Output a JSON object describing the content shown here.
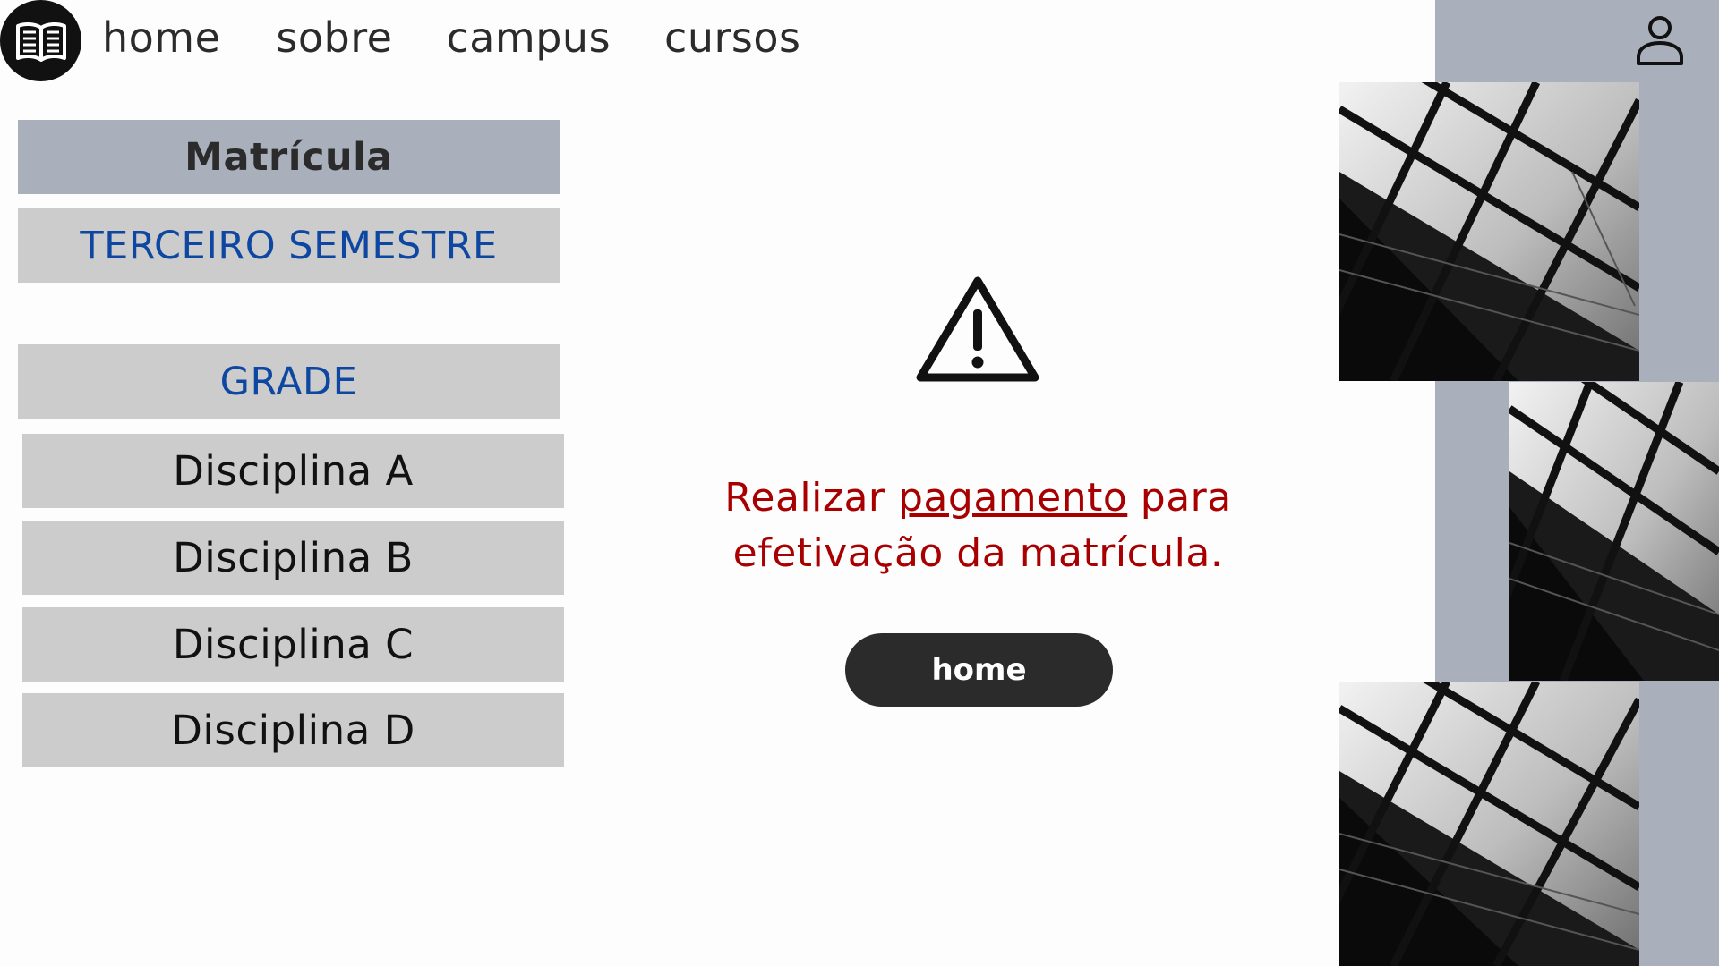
{
  "nav": {
    "logo_icon": "open-book-icon",
    "items": [
      "home",
      "sobre",
      "campus",
      "cursos"
    ],
    "user_icon": "user-profile-icon"
  },
  "panel": {
    "title": "Matrícula",
    "semester": "TERCEIRO SEMESTRE",
    "grade_label": "GRADE",
    "disciplines": [
      "Disciplina A",
      "Disciplina B",
      "Disciplina C",
      "Disciplina D"
    ]
  },
  "alert": {
    "icon": "warning-icon",
    "text_before": "Realizar ",
    "link_text": "pagamento",
    "text_after": " para efetivação da matrícula.",
    "button_label": "home"
  },
  "colors": {
    "accent_gray": "#a9afbb",
    "box_gray": "#cccccc",
    "blue_text": "#0d47a1",
    "alert_red": "#a80000",
    "dark": "#2b2b2b"
  }
}
